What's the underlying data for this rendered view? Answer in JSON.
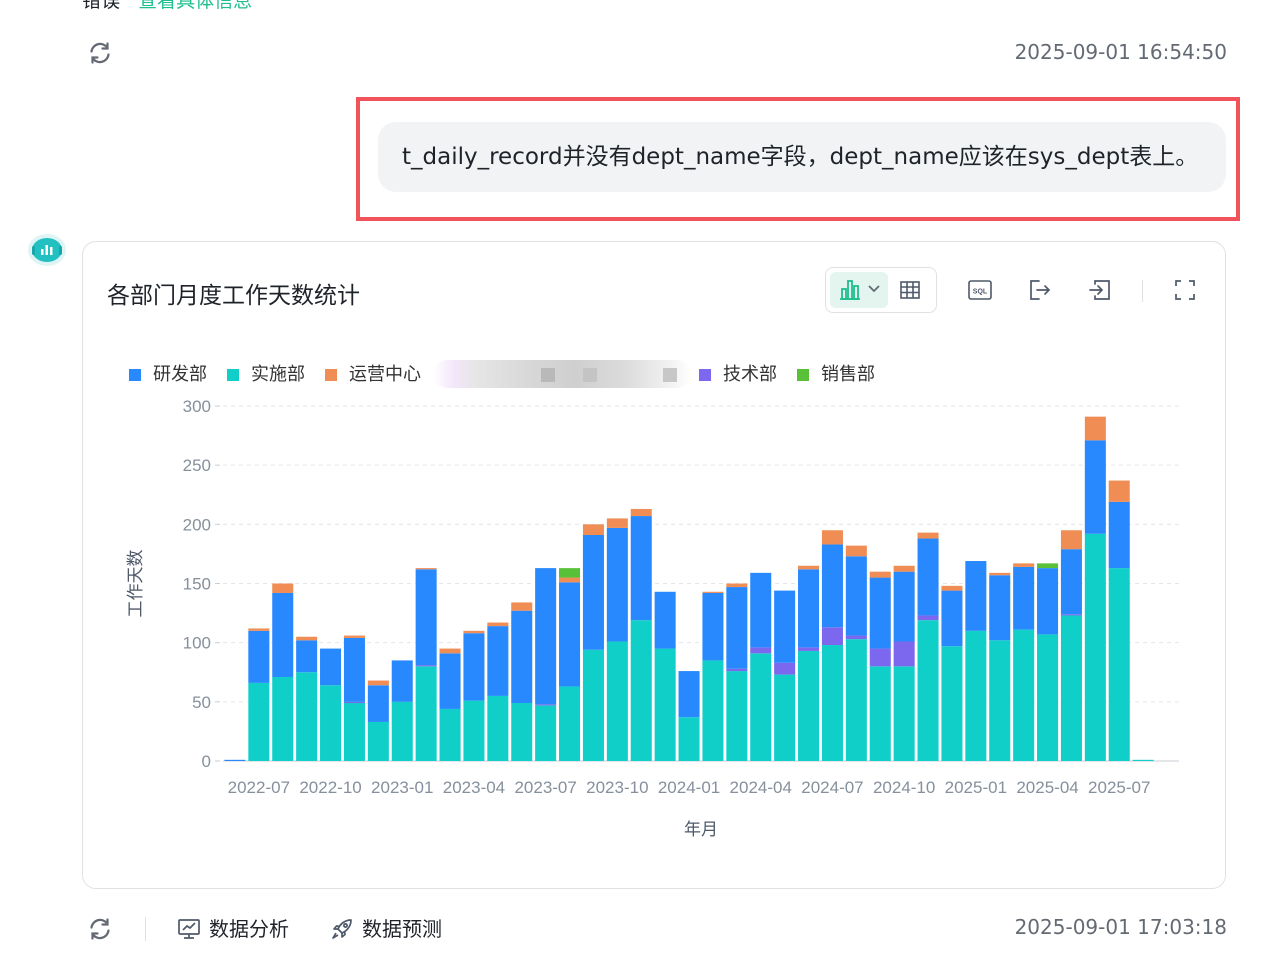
{
  "top_fragment": {
    "label": "错误",
    "link": "查看具体信息"
  },
  "timestamps": {
    "first": "2025-09-01 16:54:50",
    "second": "2025-09-01 17:03:18"
  },
  "user_message": "t_daily_record并没有dept_name字段，dept_name应该在sys_dept表上。",
  "chart_card": {
    "title": "各部门月度工作天数统计",
    "toolbar": {
      "chart_type_icon": "bar-chart-icon",
      "dropdown_icon": "chevron-down-icon",
      "table_icon": "table-icon",
      "sql_icon": "sql-icon",
      "sql_icon_text": "SQL",
      "export_icon": "export-icon",
      "add_icon": "add-to-dashboard-icon",
      "fullscreen_icon": "fullscreen-icon"
    }
  },
  "chart_data": {
    "type": "bar",
    "stacked": true,
    "xlabel": "年月",
    "ylabel": "工作天数",
    "ylim": [
      0,
      300
    ],
    "yticks": [
      0,
      50,
      100,
      150,
      200,
      250,
      300
    ],
    "grid": true,
    "legend_position": "top-left",
    "categories": [
      "2022-06",
      "2022-07",
      "2022-08",
      "2022-09",
      "2022-10",
      "2022-11",
      "2022-12",
      "2023-01",
      "2023-02",
      "2023-03",
      "2023-04",
      "2023-05",
      "2023-06",
      "2023-07",
      "2023-08",
      "2023-09",
      "2023-10",
      "2023-11",
      "2023-12",
      "2024-01",
      "2024-02",
      "2024-03",
      "2024-04",
      "2024-05",
      "2024-06",
      "2024-07",
      "2024-08",
      "2024-09",
      "2024-10",
      "2024-11",
      "2024-12",
      "2025-01",
      "2025-02",
      "2025-03",
      "2025-04",
      "2025-05",
      "2025-06",
      "2025-07",
      "2025-08",
      "2025-09"
    ],
    "xtick_labels": [
      "2022-07",
      "2022-10",
      "2023-01",
      "2023-04",
      "2023-07",
      "2023-10",
      "2024-01",
      "2024-04",
      "2024-07",
      "2024-10",
      "2025-01",
      "2025-04",
      "2025-07"
    ],
    "series": [
      {
        "name": "实施部",
        "color": "#10cfc9",
        "values": [
          0,
          66,
          71,
          75,
          64,
          49,
          33,
          50,
          80,
          44,
          51,
          55,
          49,
          47,
          63,
          94,
          101,
          119,
          95,
          37,
          85,
          76,
          91,
          73,
          93,
          98,
          103,
          80,
          80,
          119,
          97,
          110,
          102,
          111,
          107,
          123,
          192,
          163,
          1,
          0
        ]
      },
      {
        "name": "技术部",
        "color": "#7b68ee",
        "values": [
          0,
          0,
          0,
          0,
          0,
          1,
          0,
          0,
          1,
          0,
          0,
          0,
          0,
          1,
          0,
          0,
          0,
          0,
          0,
          0,
          0,
          2,
          5,
          10,
          3,
          15,
          3,
          15,
          21,
          4,
          0,
          0,
          0,
          0,
          0,
          1,
          0,
          0,
          0,
          0
        ]
      },
      {
        "name": "研发部",
        "color": "#2889ff",
        "values": [
          1,
          44,
          71,
          27,
          31,
          54,
          31,
          35,
          81,
          47,
          57,
          59,
          78,
          115,
          88,
          97,
          96,
          88,
          48,
          39,
          57,
          69,
          63,
          61,
          66,
          70,
          67,
          60,
          59,
          65,
          47,
          59,
          55,
          53,
          56,
          55,
          79,
          56,
          0,
          0
        ]
      },
      {
        "name": "运营中心",
        "color": "#ef8d55",
        "values": [
          0,
          2,
          8,
          3,
          0,
          2,
          4,
          0,
          1,
          4,
          2,
          3,
          7,
          0,
          4,
          9,
          8,
          6,
          0,
          0,
          1,
          3,
          0,
          0,
          3,
          12,
          9,
          5,
          5,
          5,
          4,
          0,
          2,
          3,
          0,
          16,
          20,
          18,
          0,
          0
        ]
      },
      {
        "name": "销售部",
        "color": "#59c138",
        "values": [
          0,
          0,
          0,
          0,
          0,
          0,
          0,
          0,
          0,
          0,
          0,
          0,
          0,
          0,
          8,
          0,
          0,
          0,
          0,
          0,
          0,
          0,
          0,
          0,
          0,
          0,
          0,
          0,
          0,
          0,
          0,
          0,
          0,
          0,
          4,
          0,
          0,
          0,
          0,
          0
        ]
      }
    ],
    "legend": [
      {
        "name": "研发部",
        "color": "#2889ff"
      },
      {
        "name": "实施部",
        "color": "#10cfc9"
      },
      {
        "name": "运营中心",
        "color": "#ef8d55"
      },
      {
        "name": "技术部",
        "color": "#7b68ee"
      },
      {
        "name": "销售部",
        "color": "#59c138"
      }
    ]
  },
  "actions": {
    "refresh_icon": "refresh-icon",
    "analysis_label": "数据分析",
    "analysis_icon": "chart-analysis-icon",
    "predict_label": "数据预测",
    "predict_icon": "rocket-icon"
  },
  "avatar_icon": "assistant-avatar-icon"
}
